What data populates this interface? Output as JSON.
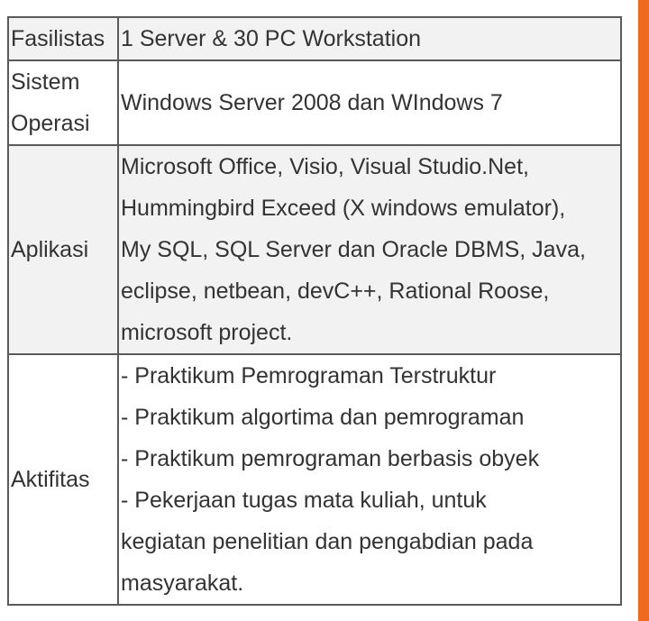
{
  "rows": [
    {
      "label_lines": [
        "Fasilistas"
      ],
      "content_lines": [
        "1 Server & 30 PC Workstation"
      ]
    },
    {
      "label_lines": [
        "Sistem",
        "Operasi"
      ],
      "content_lines": [
        "Windows Server 2008 dan WIndows 7"
      ]
    },
    {
      "label_lines": [
        "Aplikasi"
      ],
      "content_lines": [
        "Microsoft Office, Visio, Visual Studio.Net,",
        "Hummingbird Exceed (X windows emulator),",
        "My SQL, SQL Server dan Oracle DBMS, Java,",
        "eclipse, netbean, devC++, Rational Roose,",
        "microsoft project."
      ]
    },
    {
      "label_lines": [
        "Aktifitas"
      ],
      "content_lines": [
        "- Praktikum Pemrograman Terstruktur",
        "- Praktikum algortima dan pemrograman",
        "- Praktikum pemrograman berbasis obyek",
        "- Pekerjaan tugas mata kuliah, untuk",
        "kegiatan penelitian dan pengabdian pada",
        "masyarakat."
      ]
    }
  ],
  "colors": {
    "shaded_row": "#f2f2f2",
    "border": "#5a5a5a",
    "side_bar": "#f06a1d",
    "text": "#333333"
  }
}
